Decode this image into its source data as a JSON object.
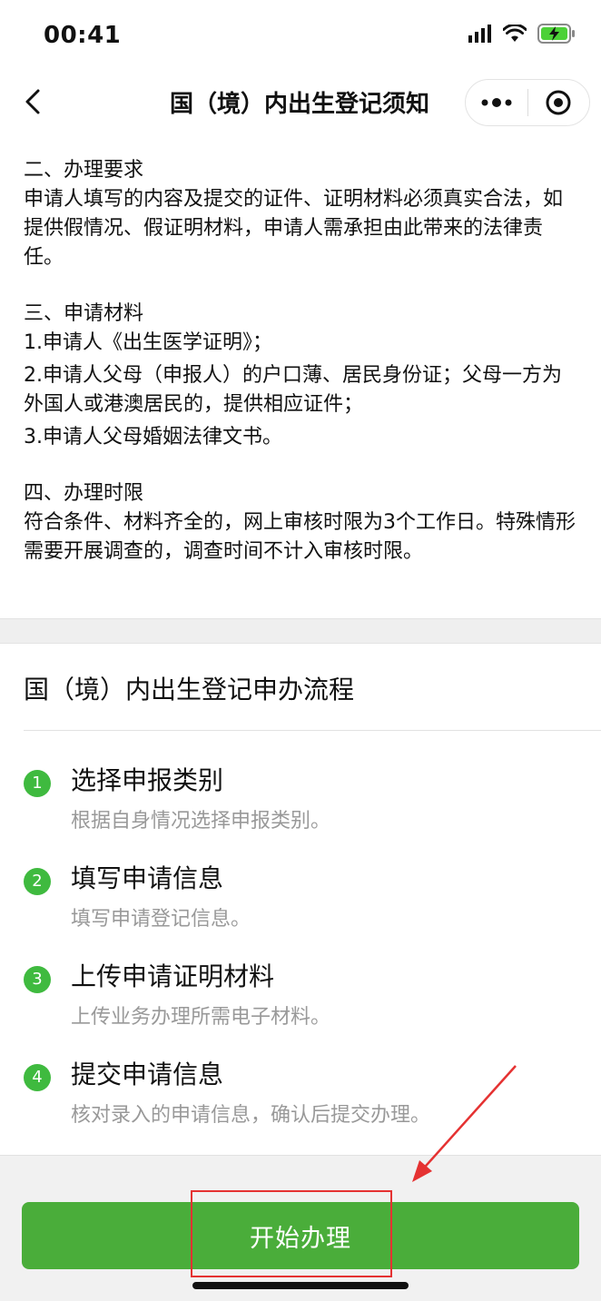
{
  "status_bar": {
    "time": "00:41"
  },
  "nav": {
    "title": "国（境）内出生登记须知"
  },
  "notice": {
    "section2_title": "二、办理要求",
    "section2_body": "申请人填写的内容及提交的证件、证明材料必须真实合法，如提供假情况、假证明材料，申请人需承担由此带来的法律责任。",
    "section3_title": "三、申请材料",
    "section3_items": [
      "1.申请人《出生医学证明》；",
      "2.申请人父母（申报人）的户口薄、居民身份证；父母一方为外国人或港澳居民的，提供相应证件；",
      "3.申请人父母婚姻法律文书。"
    ],
    "section4_title": "四、办理时限",
    "section4_body": "符合条件、材料齐全的，网上审核时限为3个工作日。特殊情形需要开展调查的，调查时间不计入审核时限。"
  },
  "process": {
    "title": "国（境）内出生登记申办流程",
    "steps": [
      {
        "num": "1",
        "title": "选择申报类别",
        "desc": "根据自身情况选择申报类别。"
      },
      {
        "num": "2",
        "title": "填写申请信息",
        "desc": "填写申请登记信息。"
      },
      {
        "num": "3",
        "title": "上传申请证明材料",
        "desc": "上传业务办理所需电子材料。"
      },
      {
        "num": "4",
        "title": "提交申请信息",
        "desc": "核对录入的申请信息，确认后提交办理。"
      }
    ]
  },
  "actions": {
    "start_label": "开始办理"
  },
  "colors": {
    "accent_green": "#4aad3a",
    "step_green": "#3fba3f",
    "annotation_red": "#e53232"
  },
  "icons": [
    "signal-icon",
    "wifi-icon",
    "battery-charging-icon",
    "back-icon",
    "more-icon",
    "close-target-icon"
  ]
}
